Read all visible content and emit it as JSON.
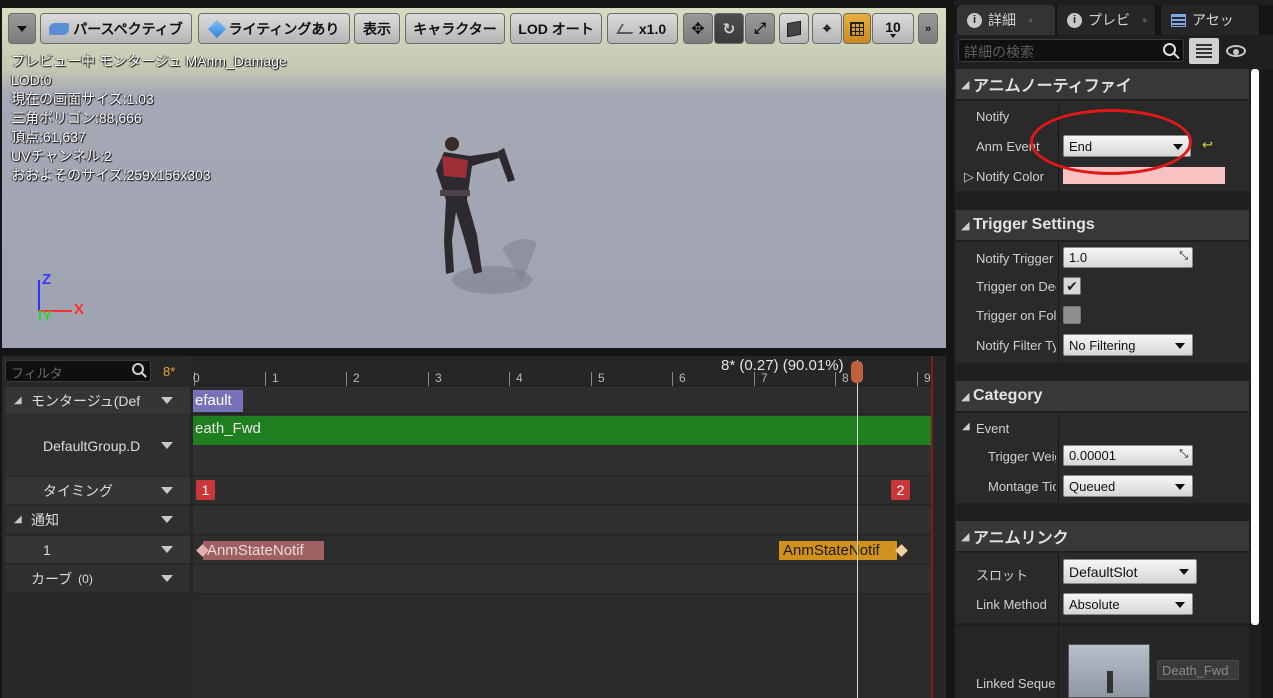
{
  "viewport": {
    "toolbar": {
      "perspective": "パースペクティブ",
      "lighting": "ライティングあり",
      "show": "表示",
      "character": "キャラクター",
      "lod": "LOD オート",
      "speed": "x1.0",
      "grid_count": "10"
    },
    "stats": [
      "プレビュー中 モンタージュ MAnm_Damage",
      "LOD:0",
      "現在の画面サイズ:1.03",
      "三角ポリゴン:88,666",
      "頂点:61,637",
      "UVチャンネル:2",
      "おおよそのサイズ:259x156x303"
    ],
    "axes": {
      "z": "Z",
      "x": "X",
      "y": "Y"
    }
  },
  "timeline": {
    "filter_placeholder": "フィルタ",
    "frame_badge": "8*",
    "playhead_label": "8* (0.27) (90.01%)",
    "ruler_labels": [
      "0",
      "1",
      "2",
      "3",
      "4",
      "5",
      "6",
      "7",
      "8",
      "9"
    ],
    "tracks": {
      "montage": "モンタージュ(Def",
      "default_group": "DefaultGroup.D",
      "timing": "タイミング",
      "notify": "通知",
      "notify_1": "1",
      "curves": "カーブ",
      "curves_count": "(0)"
    },
    "section_label": "efault",
    "anim_segment": "eath_Fwd",
    "markers": [
      "1",
      "2"
    ],
    "notify_left": "AnmStateNotif",
    "notify_right": "AnmStateNotif"
  },
  "panel": {
    "tabs": [
      "詳細",
      "プレビ",
      "アセッ"
    ],
    "search_placeholder": "詳細の検索",
    "sections": {
      "notify": {
        "title": "アニムノーティファイ",
        "notify_label": "Notify",
        "anm_event_label": "Anm Event",
        "anm_event_value": "End",
        "notify_color_label": "Notify Color",
        "notify_color": "#f8c2c2"
      },
      "trigger": {
        "title": "Trigger Settings",
        "notify_trigger_label": "Notify Trigger",
        "notify_trigger_value": "1.0",
        "trigger_on_ded_label": "Trigger on Ded",
        "trigger_on_ded_checked": true,
        "trigger_on_fol_label": "Trigger on Foll",
        "trigger_on_fol_checked": false,
        "notify_filter_label": "Notify Filter Ty",
        "notify_filter_value": "No Filtering"
      },
      "category": {
        "title": "Category",
        "event_label": "Event",
        "trigger_weight_label": "Trigger Weig",
        "trigger_weight_value": "0.00001",
        "montage_tick_label": "Montage Tic",
        "montage_tick_value": "Queued"
      },
      "anim_link": {
        "title": "アニムリンク",
        "slot_label": "スロット",
        "slot_value": "DefaultSlot",
        "link_method_label": "Link Method",
        "link_method_value": "Absolute",
        "linked_sequence_label": "Linked Sequer",
        "linked_sequence_value": "Death_Fwd"
      }
    }
  },
  "colors": {
    "anim_segment": "#1f7f1f",
    "section": "#7672b8",
    "marker": "#c9373a",
    "notify_left": "#9e6060",
    "notify_right": "#d0921d",
    "highlight_circle": "#e01818",
    "accent": "#e6a430"
  }
}
